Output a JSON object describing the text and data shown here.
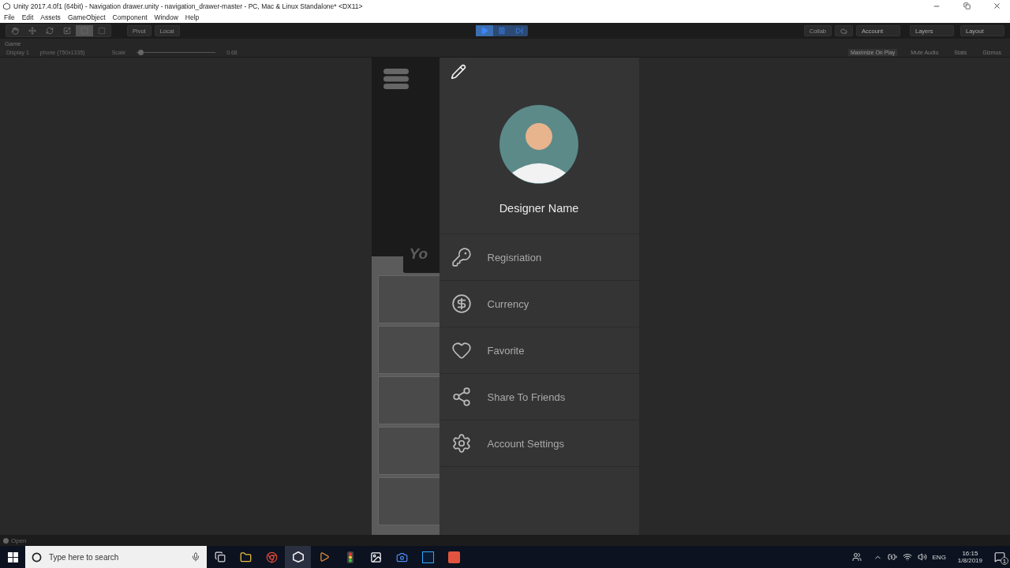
{
  "window": {
    "title": "Unity 2017.4.0f1 (64bit) - Navigation drawer.unity - navigation_drawer-master - PC, Mac & Linux Standalone* <DX11>"
  },
  "menu": [
    "File",
    "Edit",
    "Assets",
    "GameObject",
    "Component",
    "Window",
    "Help"
  ],
  "toolbar": {
    "pivot": "Pivot",
    "local": "Local",
    "playing": true,
    "collab": "Collab",
    "account": "Account",
    "layers": "Layers",
    "layout": "Layout"
  },
  "game_tab": {
    "title": "Game",
    "display": "Display 1",
    "resolution": "phone (750x1335)",
    "scale_label": "Scale",
    "scale_slider": {
      "level": 0.02
    },
    "scale": "0.68",
    "options": [
      {
        "label": "Maximize On Play",
        "selected": true
      },
      {
        "label": "Mute Audio",
        "selected": false
      },
      {
        "label": "Stats",
        "selected": false
      },
      {
        "label": "Gizmos",
        "selected": false
      }
    ]
  },
  "app": {
    "card_text": "Yo",
    "drawer": {
      "user_name": "Designer Name",
      "items": [
        {
          "label": "Regisriation"
        },
        {
          "label": "Currency"
        },
        {
          "label": "Favorite"
        },
        {
          "label": "Share To Friends"
        },
        {
          "label": "Account Settings"
        }
      ]
    }
  },
  "status": "Open",
  "taskbar": {
    "search_placeholder": "Type here to search",
    "language": "ENG",
    "time": "16:15",
    "date": "1/8/2019",
    "notifications": "1"
  }
}
